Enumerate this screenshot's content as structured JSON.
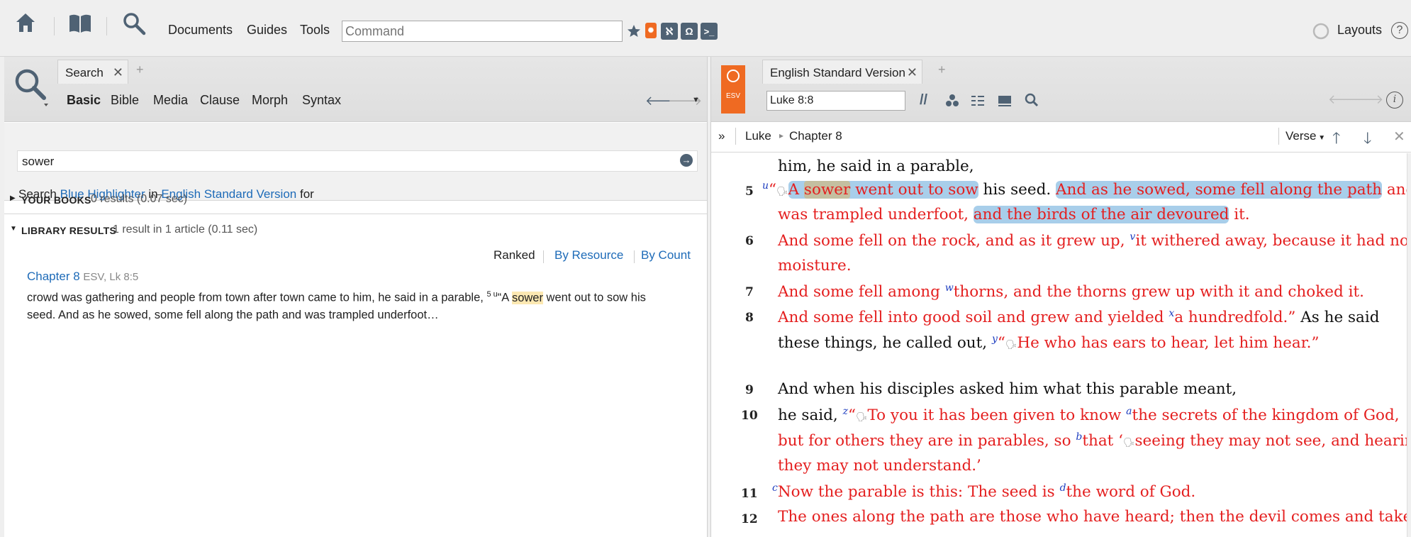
{
  "toolbar": {
    "documents": "Documents",
    "guides": "Guides",
    "tools": "Tools",
    "command_placeholder": "Command",
    "layouts": "Layouts",
    "help": "?"
  },
  "left": {
    "tab_label": "Search",
    "tab_close": "✕",
    "tab_plus": "+",
    "subtabs": [
      "Basic",
      "Bible",
      "Media",
      "Clause",
      "Morph",
      "Syntax"
    ],
    "search_prefix": "Search",
    "highlighter": "Blue Highlighter",
    "in_label": "in",
    "version": "English Standard Version",
    "for_label": "for",
    "query": "sower",
    "your_books_title": "YOUR BOOKS",
    "your_books_meta": "0 results (0.07 sec)",
    "library_title": "LIBRARY RESULTS",
    "library_meta": "1 result in 1 article (0.11 sec)",
    "sort": {
      "ranked": "Ranked",
      "by_resource": "By Resource",
      "by_count": "By Count"
    },
    "result": {
      "title": "Chapter 8",
      "ref": "ESV, Lk 8:5",
      "line1_pre": "crowd was gathering and people from town after town came to him, he said in a parable,",
      "line1_sup": "5 u",
      "line1_quote": "“A",
      "line1_hl": "sower",
      "line1_post": "went out to sow his",
      "line2": "seed. And as he sowed, some fell along the path and was trampled underfoot…"
    }
  },
  "right": {
    "tab_label": "English Standard Version",
    "tab_close": "✕",
    "tab_plus": "+",
    "esv_badge": "ESV",
    "reference": "Luke 8:8",
    "breadcrumb_book": "Luke",
    "breadcrumb_chapter": "Chapter 8",
    "verse_menu": "Verse",
    "expand": "»",
    "verses": {
      "l0": "him, he said in a parable,",
      "v5": "5",
      "v5_note": "u",
      "v5_a1": "“",
      "v5_a2": "A",
      "v5_sower": "sower",
      "v5_a3": "went out to sow",
      "v5_a4": "his seed.",
      "v5_a5": "And as he sowed, some fell along the path",
      "v5_a6": "and",
      "v5_b1": "was trampled underfoot,",
      "v5_b2": "and the birds of the air devoured",
      "v5_b3": "it.",
      "v6": "6",
      "v6_a1": "And some fell on the rock, and as it grew up,",
      "v6_note": "v",
      "v6_a2": "it withered away, because it had no",
      "v6_b1": "moisture.",
      "v7": "7",
      "v7_a1": "And some fell among",
      "v7_note": "w",
      "v7_a2": "thorns, and the thorns grew up with it and choked it.",
      "v8": "8",
      "v8_a1": "And some fell into good soil and grew and yielded",
      "v8_note": "x",
      "v8_a2": "a hundredfold.”",
      "v8_a3": "As he said",
      "v8_b1": "these things, he called out,",
      "v8_note2": "y",
      "v8_b2": "“",
      "v8_b3": "He who has ears to hear, let him hear.”",
      "v9": "9",
      "v9_a1": "And when his disciples asked him what this parable meant,",
      "v10": "10",
      "v10_a1": "he said,",
      "v10_note": "z",
      "v10_a2": "“",
      "v10_a3": "To you it has been given to know",
      "v10_note2": "a",
      "v10_a4": "the secrets of the kingdom of God,",
      "v10_b1": "but for others they are in parables, so",
      "v10_note3": "b",
      "v10_b2": "that ‘",
      "v10_b3": "seeing they may not see, and hearing",
      "v10_c1": "they may not understand.’",
      "v11": "11",
      "v11_note": "c",
      "v11_a1": "Now the parable is this: The seed is",
      "v11_note2": "d",
      "v11_a2": "the word of God.",
      "v12": "12",
      "v12_a1": "The ones along the path are those who have heard; then the devil comes and takes"
    }
  },
  "colors": {
    "words_of_christ": "#e41f1f",
    "link_blue": "#1e6bb8",
    "esv_orange": "#ef6a22",
    "highlight_blue": "#79b3de"
  }
}
